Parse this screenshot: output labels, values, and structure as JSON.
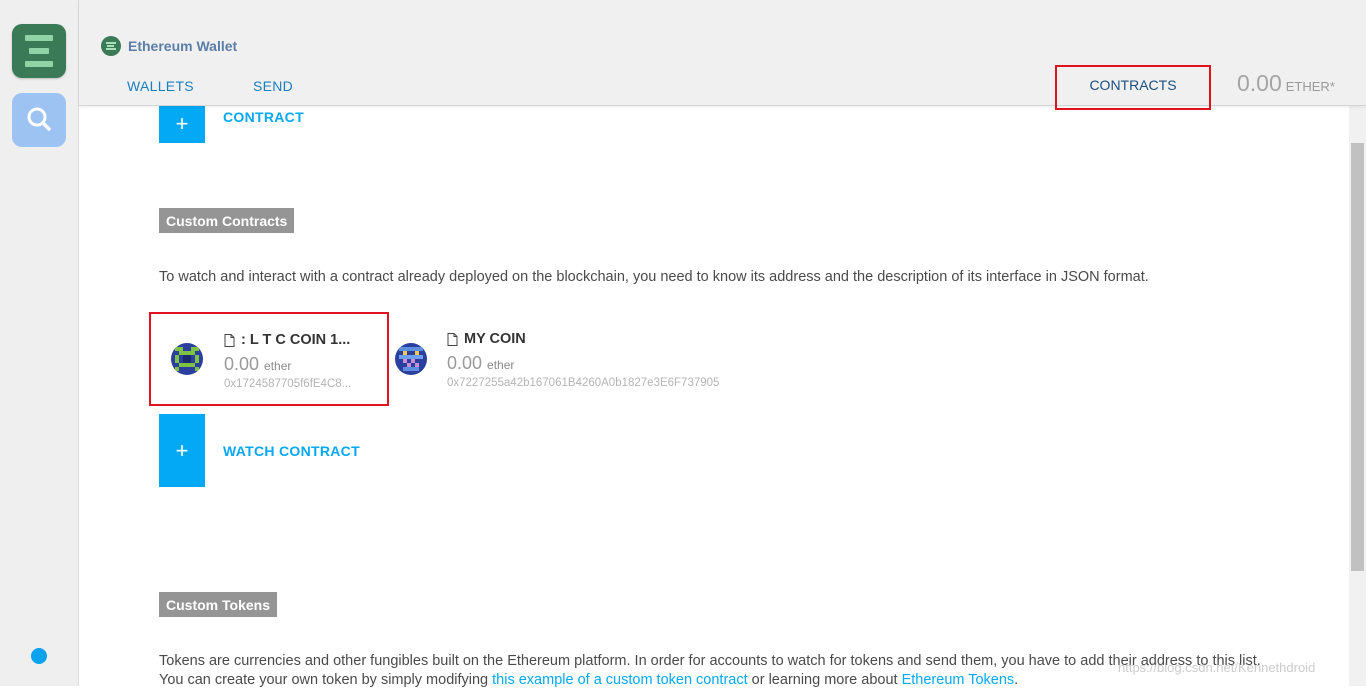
{
  "header": {
    "app_title": "Ethereum Wallet",
    "nav": {
      "wallets": "WALLETS",
      "send": "SEND",
      "contracts": "CONTRACTS"
    },
    "balance": {
      "amount": "0.00",
      "unit": "ETHER*"
    }
  },
  "actions": {
    "plus_symbol": "+",
    "deploy_contract": "CONTRACT",
    "watch_contract": "WATCH CONTRACT"
  },
  "custom_contracts": {
    "heading": "Custom Contracts",
    "description": "To watch and interact with a contract already deployed on the blockchain, you need to know its address and the description of its interface in JSON format.",
    "items": [
      {
        "name": ": L T C COIN 1...",
        "balance": "0.00",
        "unit": "ether",
        "address": "0x1724587705f6fE4C8..."
      },
      {
        "name": "MY COIN",
        "balance": "0.00",
        "unit": "ether",
        "address": "0x7227255a42b167061B4260A0b1827e3E6F737905"
      }
    ]
  },
  "custom_tokens": {
    "heading": "Custom Tokens",
    "line1": "Tokens are currencies and other fungibles built on the Ethereum platform. In order for accounts to watch for tokens and send them, you have to add their address to this list.",
    "line2_prefix": "You can create your own token by simply modifying ",
    "link1": "this example of a custom token contract",
    "line2_mid": " or learning more about ",
    "link2": "Ethereum Tokens",
    "line2_suffix": "."
  },
  "watermark": "https://blog.csdn.net/Kennethdroid",
  "colors": {
    "accent": "#03a9f4",
    "highlight_box": "#e0141f",
    "brand_green": "#3b7a57"
  }
}
